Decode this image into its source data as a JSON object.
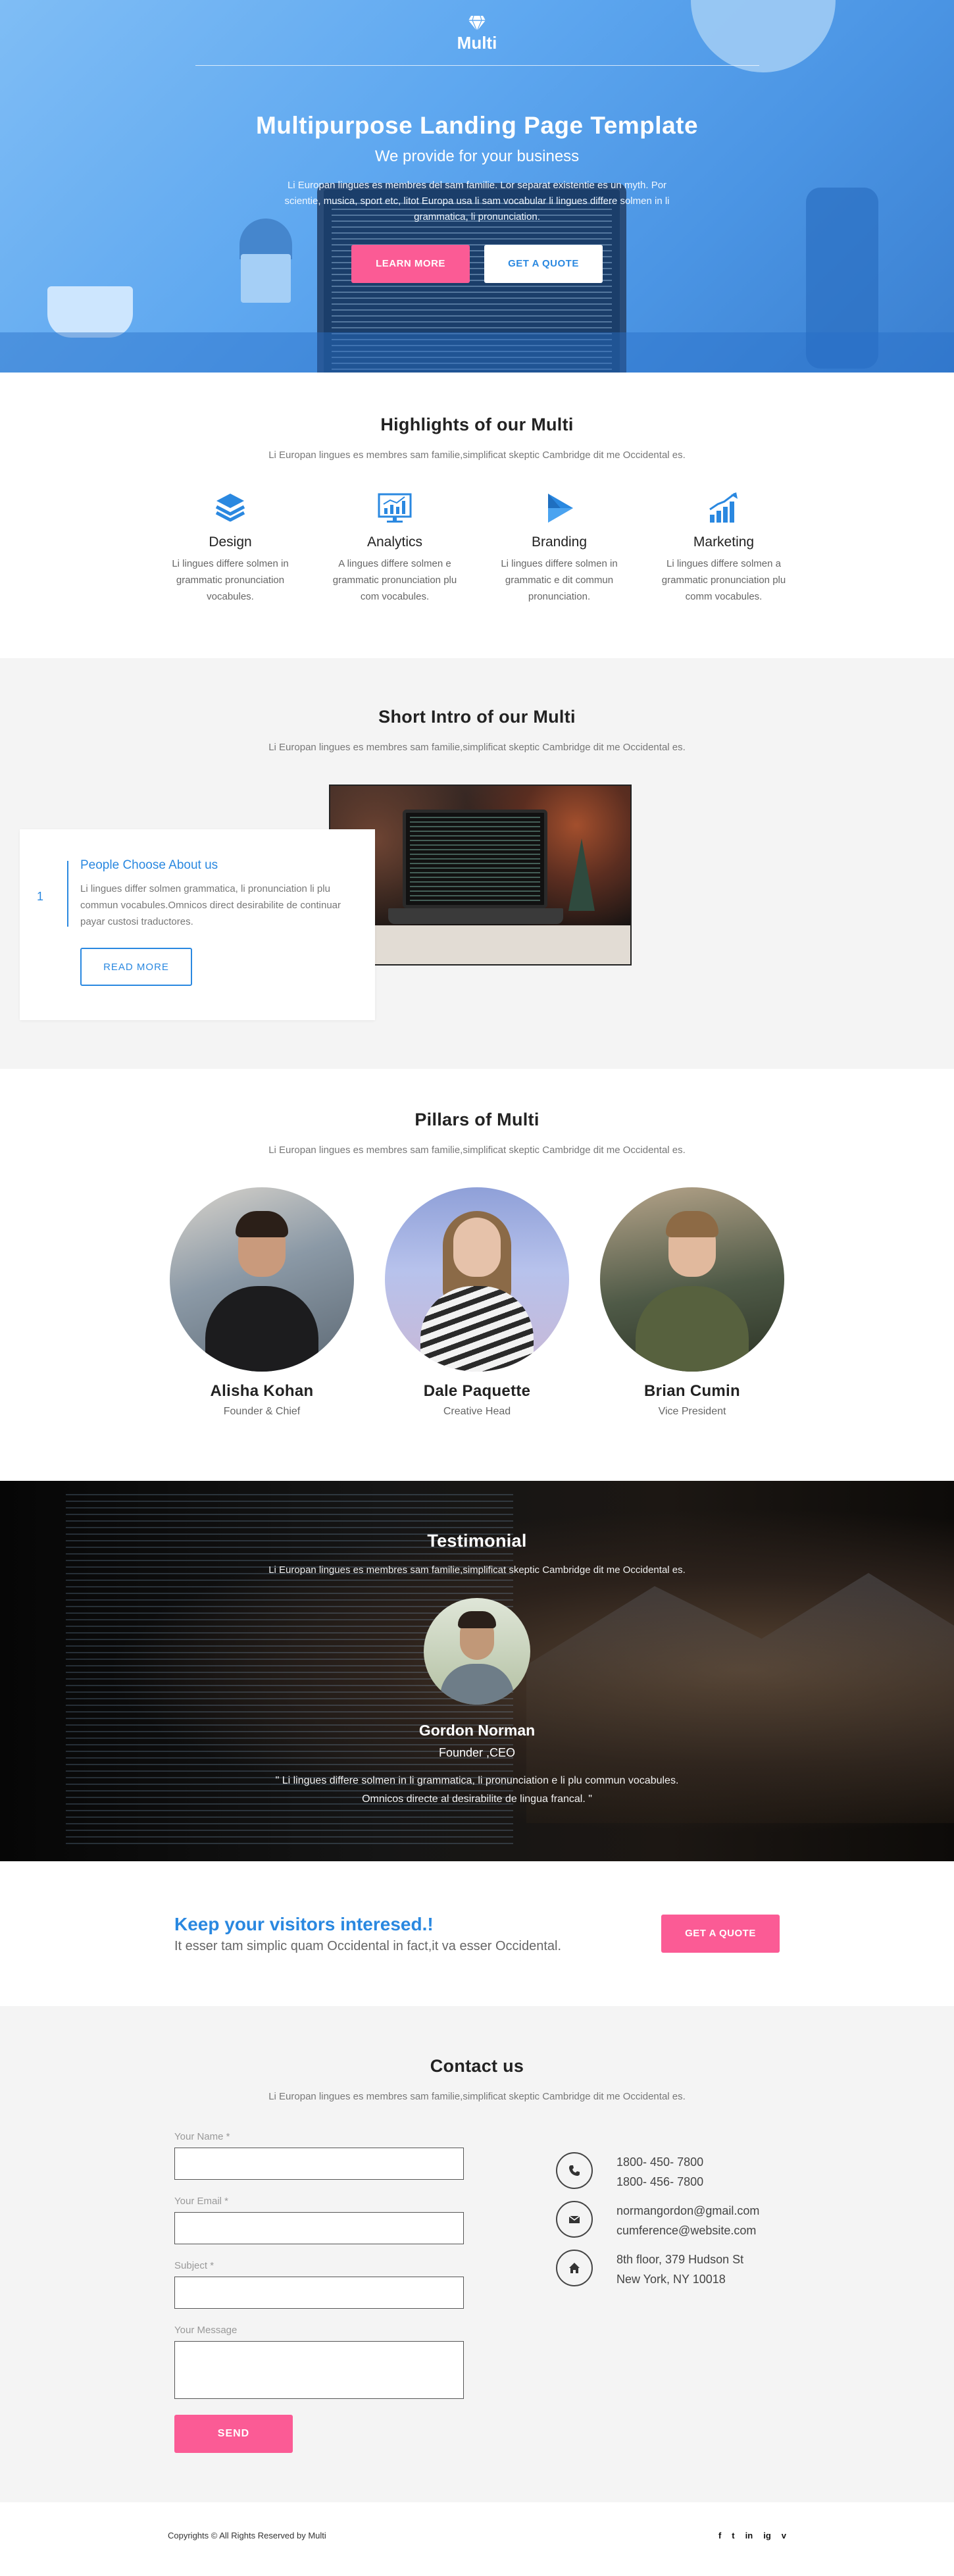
{
  "hero": {
    "brand": "Multi",
    "title": "Multipurpose Landing Page Template",
    "subtitle": "We provide for your business",
    "text": "Li Europan lingues es membres del sam familie. Lor separat existentie es un myth. Por scientie, musica, sport etc, litot Europa usa li sam vocabular li lingues differe solmen in li grammatica, li pronunciation.",
    "btn_learn": "Learn More",
    "btn_quote": "Get A Quote"
  },
  "highlights": {
    "title": "Highlights of our Multi",
    "sub": "Li Europan lingues es membres sam familie,simplificat skeptic Cambridge dit me Occidental es.",
    "items": [
      {
        "icon": "layers-icon",
        "title": "Design",
        "text": "Li lingues differe solmen in grammatic pronunciation vocabules."
      },
      {
        "icon": "analytics-chart-icon",
        "title": "Analytics",
        "text": "A lingues differe solmen e grammatic pronunciation plu com vocabules."
      },
      {
        "icon": "play-arrow-icon",
        "title": "Branding",
        "text": "Li lingues differe solmen in grammatic  e dit commun pronunciation."
      },
      {
        "icon": "growth-bars-icon",
        "title": "Marketing",
        "text": "Li lingues differe solmen a grammatic pronunciation plu comm vocabules."
      }
    ]
  },
  "intro": {
    "title": "Short Intro of our Multi",
    "sub": "Li Europan lingues es membres sam familie,simplificat skeptic Cambridge dit me Occidental es.",
    "num": "1",
    "card_title": "People Choose About us",
    "card_text": "Li lingues differ solmen grammatica, li pronunciation li plu commun vocabules.Omnicos direct desirabilite de continuar payar custosi traductores.",
    "btn": "READ MORE"
  },
  "pillars": {
    "title": "Pillars of Multi",
    "sub": "Li Europan lingues es membres sam familie,simplificat skeptic Cambridge dit me Occidental es.",
    "members": [
      {
        "name": "Alisha Kohan",
        "role": "Founder & Chief"
      },
      {
        "name": "Dale Paquette",
        "role": "Creative Head"
      },
      {
        "name": "Brian Cumin",
        "role": "Vice President"
      }
    ]
  },
  "testimonial": {
    "title": "Testimonial",
    "sub": "Li Europan lingues es membres sam familie,simplificat skeptic Cambridge dit me Occidental es.",
    "name": "Gordon Norman",
    "role": "Founder ,CEO",
    "quote": "\" Li lingues differe solmen in li grammatica, li pronunciation e li plu commun vocabules. Omnicos directe al desirabilite de lingua francal. \""
  },
  "cta": {
    "title": "Keep your visitors interesed.!",
    "text": "It esser tam simplic quam Occidental in fact,it va esser Occidental.",
    "btn": "Get A Quote"
  },
  "contact": {
    "title": "Contact us",
    "sub": "Li Europan lingues es membres sam familie,simplificat skeptic Cambridge dit me Occidental es.",
    "labels": {
      "name": "Your Name *",
      "email": "Your Email *",
      "subject": "Subject *",
      "message": "Your Message"
    },
    "send": "SEND",
    "phone1": "1800- 450- 7800",
    "phone2": "1800- 456- 7800",
    "email1": "normangordon@gmail.com",
    "email2": "cumference@website.com",
    "addr1": "8th floor, 379 Hudson St",
    "addr2": "New York, NY 10018"
  },
  "footer": {
    "copy": "Copyrights © All Rights Reserved by Multi",
    "socials": [
      "f",
      "t",
      "in",
      "ig",
      "v"
    ]
  },
  "colors": {
    "primary": "#2a88e0",
    "accent": "#fb5b95",
    "hero": "#5fa8f0"
  }
}
